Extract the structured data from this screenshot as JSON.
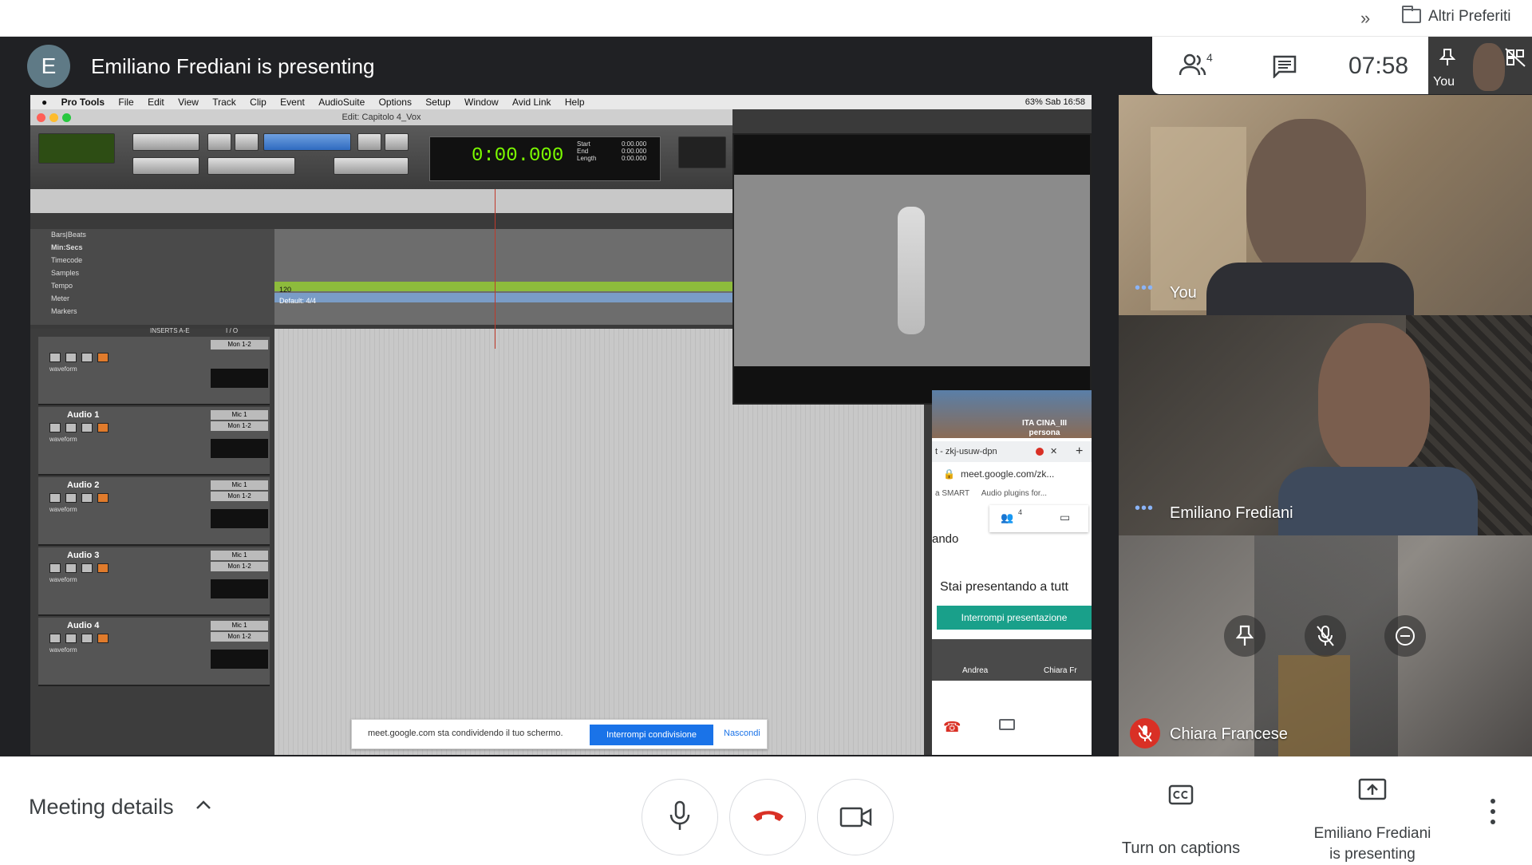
{
  "bookmarks": {
    "more_glyph": "»",
    "folder_label": "Altri Preferiti"
  },
  "stage": {
    "presenter_initial": "E",
    "presenting_title": "Emiliano Frediani is presenting"
  },
  "shared_screen": {
    "mac_menu": [
      "Pro Tools",
      "File",
      "Edit",
      "View",
      "Track",
      "Clip",
      "Event",
      "AudioSuite",
      "Options",
      "Setup",
      "Window",
      "Avid Link",
      "Help"
    ],
    "mac_status": "63%   Sab 16:58",
    "window_title": "Edit: Capitolo 4_Vox",
    "counter": "0:00.000",
    "counter_side": [
      "Start",
      "End",
      "Length"
    ],
    "counter_side_values": [
      "0:00.000",
      "0:00.000",
      "0:00.000"
    ],
    "ruler_labels": [
      "Bars|Beats",
      "Min:Secs",
      "Timecode",
      "Samples",
      "Tempo",
      "Meter",
      "Markers"
    ],
    "tempo_value": "120",
    "meter_value": "Default: 4/4",
    "tracks": [
      {
        "name": "",
        "io_in": "Mon 1-2",
        "io_out": ""
      },
      {
        "name": "Audio 1",
        "io_in": "Mic 1",
        "io_out": "Mon 1-2"
      },
      {
        "name": "Audio 2",
        "io_in": "Mic 1",
        "io_out": "Mon 1-2"
      },
      {
        "name": "Audio 3",
        "io_in": "Mic 1",
        "io_out": "Mon 1-2"
      },
      {
        "name": "Audio 4",
        "io_in": "Mic 1",
        "io_out": "Mon 1-2"
      }
    ],
    "track_view": "waveform",
    "inserts_header": "INSERTS A-E",
    "io_header": "I / O",
    "notification": {
      "text": "meet.google.com sta condividendo il tuo schermo.",
      "stop_label": "Interrompi condivisione",
      "hide_label": "Nascondi"
    },
    "mini_meet": {
      "mountain_label": "ITA CINA_III persona",
      "tab_label": "t - zkj-usuw-dpn",
      "url": "meet.google.com/zk...",
      "bookmark_1": "a SMART",
      "bookmark_2": "Audio plugins for...",
      "people_count": "4",
      "ando": "ando",
      "presenting_text": "Stai presentando a tutt",
      "stop_label": "Interrompi presentazione",
      "thumb_a": "Andrea",
      "thumb_c": "Chiara Fr"
    }
  },
  "topbar": {
    "people_count": "4",
    "clock": "07:58",
    "self_label": "You"
  },
  "tiles": [
    {
      "name": "You",
      "muted": false
    },
    {
      "name": "Emiliano Frediani",
      "muted": false
    },
    {
      "name": "Chiara Francese",
      "muted": true
    }
  ],
  "bottombar": {
    "meeting_details": "Meeting details",
    "captions_label": "Turn on captions",
    "present_label_line1": "Emiliano Frediani",
    "present_label_line2": "is presenting"
  },
  "colors": {
    "hangup_red": "#d93025",
    "accent_blue": "#1a73e8",
    "teal": "#19a08a"
  },
  "icons": [
    "folder-icon",
    "people-icon",
    "chat-icon",
    "pin-icon",
    "mic-icon",
    "hangup-icon",
    "camera-icon",
    "captions-icon",
    "present-icon",
    "more-vert-icon",
    "mic-off-icon",
    "remove-icon"
  ]
}
